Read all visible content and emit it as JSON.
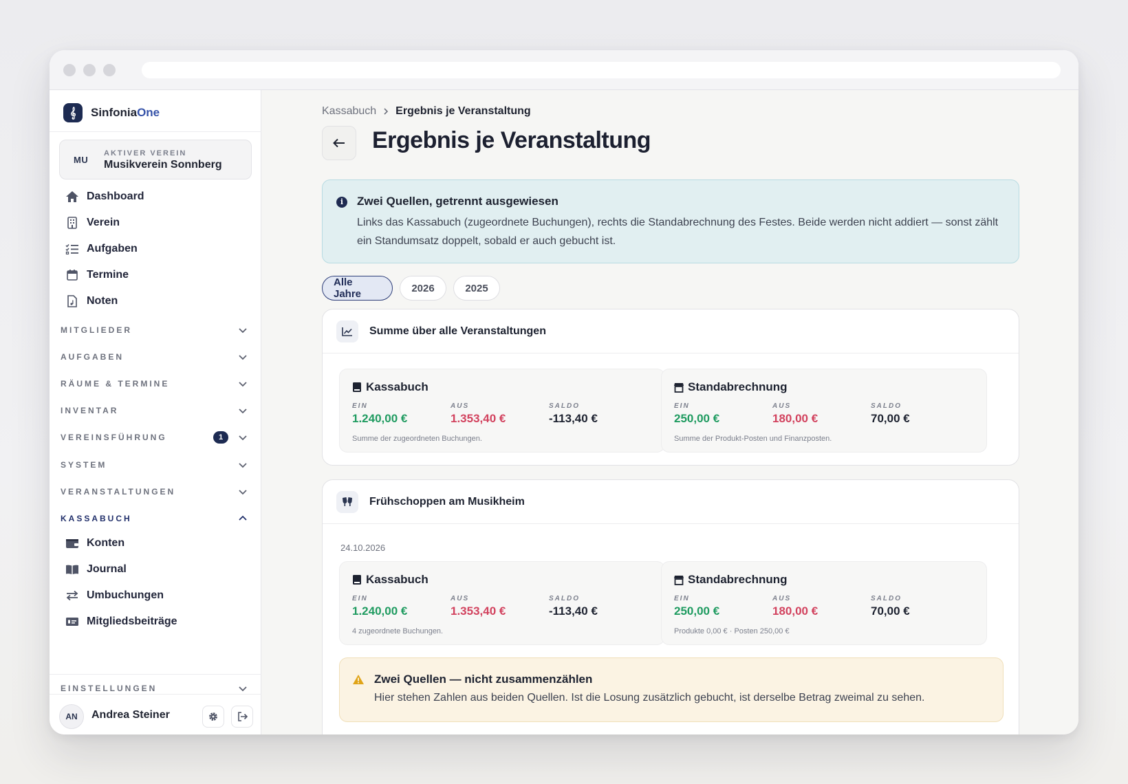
{
  "brand": {
    "name_main": "Sinfonia",
    "name_accent": "One"
  },
  "club": {
    "badge": "MU",
    "label": "AKTIVER VEREIN",
    "name": "Musikverein Sonnberg"
  },
  "nav": {
    "items": [
      {
        "label": "Dashboard",
        "icon": "home-icon"
      },
      {
        "label": "Verein",
        "icon": "building-icon"
      },
      {
        "label": "Aufgaben",
        "icon": "list-check-icon"
      },
      {
        "label": "Termine",
        "icon": "calendar-icon"
      },
      {
        "label": "Noten",
        "icon": "document-music-icon"
      }
    ],
    "sections": [
      {
        "label": "MITGLIEDER"
      },
      {
        "label": "AUFGABEN"
      },
      {
        "label": "RÄUME & TERMINE"
      },
      {
        "label": "INVENTAR"
      },
      {
        "label": "VEREINSFÜHRUNG",
        "badge": "1"
      },
      {
        "label": "SYSTEM"
      },
      {
        "label": "VERANSTALTUNGEN"
      },
      {
        "label": "KASSABUCH",
        "expanded": true
      }
    ],
    "kassabuch_items": [
      {
        "label": "Konten",
        "icon": "wallet-icon"
      },
      {
        "label": "Journal",
        "icon": "book-open-icon"
      },
      {
        "label": "Umbuchungen",
        "icon": "arrows-exchange-icon"
      },
      {
        "label": "Mitgliedsbeiträge",
        "icon": "money-card-icon"
      }
    ],
    "settings_section": {
      "label": "EINSTELLUNGEN"
    }
  },
  "user": {
    "initials": "AN",
    "name": "Andrea Steiner"
  },
  "breadcrumb": {
    "parent": "Kassabuch",
    "current": "Ergebnis je Veranstaltung"
  },
  "page": {
    "title": "Ergebnis je Veranstaltung"
  },
  "info": {
    "title": "Zwei Quellen, getrennt ausgewiesen",
    "text": "Links das Kassabuch (zugeordnete Buchungen), rechts die Standabrechnung des Festes. Beide werden nicht addiert — sonst zählt ein Standumsatz doppelt, sobald er auch gebucht ist."
  },
  "filters": {
    "options": [
      "Alle Jahre",
      "2026",
      "2025"
    ],
    "selected": "Alle Jahre"
  },
  "summary": {
    "title": "Summe über alle Veranstaltungen",
    "kassabuch": {
      "title": "Kassabuch",
      "in_label": "EIN",
      "in_value": "1.240,00 €",
      "out_label": "AUS",
      "out_value": "1.353,40 €",
      "saldo_label": "SALDO",
      "saldo_value": "-113,40 €",
      "note": "Summe der zugeordneten Buchungen."
    },
    "stand": {
      "title": "Standabrechnung",
      "in_label": "EIN",
      "in_value": "250,00 €",
      "out_label": "AUS",
      "out_value": "180,00 €",
      "saldo_label": "SALDO",
      "saldo_value": "70,00 €",
      "note": "Summe der Produkt-Posten und Finanzposten."
    }
  },
  "event": {
    "title": "Frühschoppen am Musikheim",
    "date": "24.10.2026",
    "kassabuch": {
      "title": "Kassabuch",
      "in_label": "EIN",
      "in_value": "1.240,00 €",
      "out_label": "AUS",
      "out_value": "1.353,40 €",
      "saldo_label": "SALDO",
      "saldo_value": "-113,40 €",
      "note": "4 zugeordnete Buchungen."
    },
    "stand": {
      "title": "Standabrechnung",
      "in_label": "EIN",
      "in_value": "250,00 €",
      "out_label": "AUS",
      "out_value": "180,00 €",
      "saldo_label": "SALDO",
      "saldo_value": "70,00 €",
      "note": "Produkte 0,00 € · Posten 250,00 €"
    },
    "warning": {
      "title": "Zwei Quellen — nicht zusammenzählen",
      "text": "Hier stehen Zahlen aus beiden Quellen. Ist die Losung zusätzlich gebucht, ist derselbe Betrag zweimal zu sehen."
    }
  },
  "colors": {
    "accent": "#1d2b52",
    "positive": "#1f9b60",
    "negative": "#d2425e",
    "info_bg": "#e1eff1",
    "warn_bg": "#fbf3e3"
  }
}
